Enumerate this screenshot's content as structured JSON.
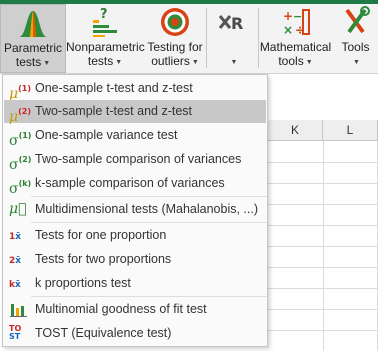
{
  "ribbon": {
    "parametric": {
      "line1": "Parametric",
      "line2": "tests"
    },
    "nonparametric": {
      "line1": "Nonparametric",
      "line2": "tests"
    },
    "outliers": {
      "line1": "Testing for",
      "line2": "outliers"
    },
    "r_button": {
      "line2": ""
    },
    "mathematical": {
      "line1": "Mathematical",
      "line2": "tools"
    },
    "tools": {
      "line1": "Tools"
    }
  },
  "grid": {
    "column_k": "K",
    "column_l": "L"
  },
  "menu": {
    "items": [
      {
        "icon": "mu1-icon",
        "label": "One-sample t-test and z-test"
      },
      {
        "icon": "mu2-icon",
        "label": "Two-sample t-test and z-test",
        "selected": true
      },
      {
        "icon": "sigma1-icon",
        "label": "One-sample variance test"
      },
      {
        "icon": "sigma2-icon",
        "label": "Two-sample comparison of variances"
      },
      {
        "icon": "sigmak-icon",
        "label": "k-sample comparison of variances"
      },
      {
        "icon": "mu-vector-icon",
        "label": "Multidimensional tests (Mahalanobis, ...)"
      },
      {
        "icon": "one-proportion-icon",
        "label": "Tests for one proportion"
      },
      {
        "icon": "two-proportion-icon",
        "label": "Tests for two proportions"
      },
      {
        "icon": "k-proportion-icon",
        "label": "k proportions test"
      },
      {
        "icon": "multinomial-icon",
        "label": "Multinomial goodness of fit test"
      },
      {
        "icon": "tost-icon",
        "label": "TOST (Equivalence test)"
      }
    ]
  },
  "colors": {
    "selected": "#c8c8c8",
    "accent_green": "#1f7a45"
  }
}
